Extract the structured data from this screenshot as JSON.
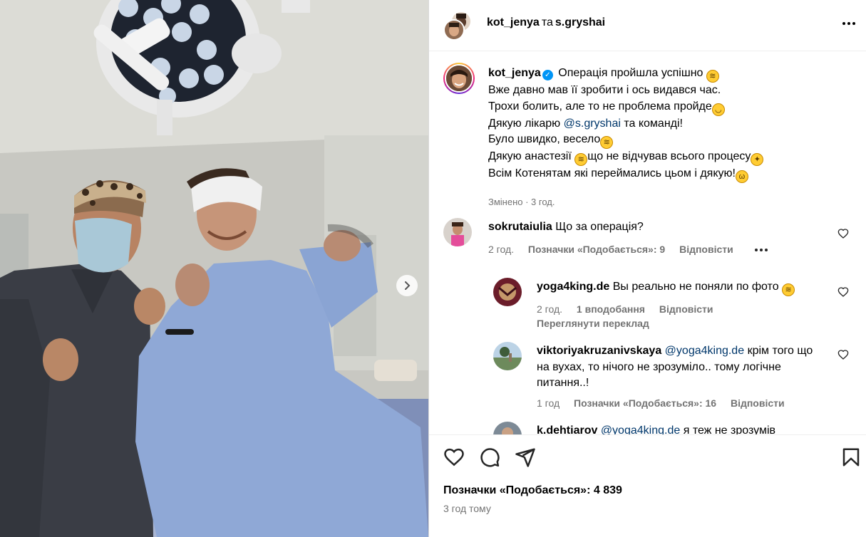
{
  "header": {
    "user1": "kot_jenya",
    "joiner": "та",
    "user2": "s.gryshai"
  },
  "caption": {
    "username": "kot_jenya",
    "line1": "Операція пройшла успішно",
    "line2": "Вже давно мав її зробити і ось видався час.",
    "line3": "Трохи болить, але то не проблема пройде",
    "line4_pre": "Дякую лікарю",
    "line4_mention": "@s.gryshai",
    "line4_post": "та команді!",
    "line5": "Було швидко, весело",
    "line6_pre": "Дякую анастезії",
    "line6_post": "що не відчував всього процесу",
    "line7": "Всім Котенятам які переймались цьом і дякую!",
    "meta": "Змінено · 3 год."
  },
  "comments": [
    {
      "username": "sokrutaiulia",
      "text": "Що за операція?",
      "time": "2 год.",
      "likes": "Позначки «Подобається»: 9",
      "reply": "Відповісти"
    },
    {
      "username": "yoga4king.de",
      "text": "Вы реально не поняли по фото",
      "time": "2 год.",
      "likes": "1 вподобання",
      "reply": "Відповісти",
      "translate": "Переглянути переклад"
    },
    {
      "username": "viktoriyakruzanivskaya",
      "mention": "@yoga4king.de",
      "text_l1": "крім того що",
      "text_l2": "на вухах, то нічого не зрозуміло.. тому логічне",
      "text_l3": "питання..!",
      "time": "1 год",
      "likes": "Позначки «Подобається»: 16",
      "reply": "Відповісти"
    },
    {
      "username": "k.dehtiarov",
      "mention": "@yoga4king.de",
      "text": "я теж не зрозумів"
    }
  ],
  "footer": {
    "likes": "Позначки «Подобається»: 4 839",
    "time": "3 год тому"
  },
  "icons": {
    "like": "heart-icon",
    "comment": "comment-icon",
    "share": "send-icon",
    "save": "bookmark-icon",
    "next": "chevron-right-icon",
    "more": "more-horizontal-icon",
    "verified": "verified-badge-icon"
  },
  "colors": {
    "link": "#00376b",
    "accent": "#0095f6",
    "muted": "#737373"
  }
}
